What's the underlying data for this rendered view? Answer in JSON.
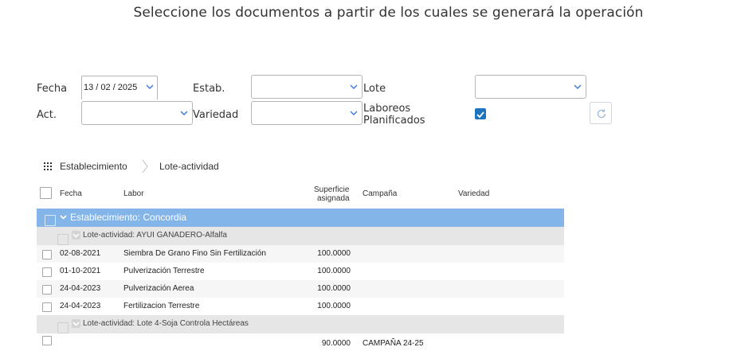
{
  "header": {
    "title": "Seleccione los documentos a partir de los cuales se generará la operación"
  },
  "filters": {
    "fecha_label": "Fecha",
    "fecha_value": "13 / 02 / 2025",
    "estab_label": "Estab.",
    "lote_label": "Lote",
    "act_label": "Act.",
    "variedad_label": "Variedad",
    "laboreos_label_1": "Laboreos",
    "laboreos_label_2": "Planificados",
    "laboreos_checked": true
  },
  "groupby": {
    "items": [
      "Establecimiento",
      "Lote-actividad"
    ]
  },
  "grid": {
    "columns": {
      "fecha": "Fecha",
      "labor": "Labor",
      "superficie_1": "Superficie",
      "superficie_2": "asignada",
      "campana": "Campaña",
      "variedad": "Variedad"
    },
    "group1": "Establecimiento: Concordia",
    "subgroups": [
      {
        "label": "Lote-actividad: AYUI GANADERO-Alfalfa",
        "rows": [
          {
            "fecha": "02-08-2021",
            "labor": "Siembra De Grano Fino Sin Fertilización",
            "superficie": "100.0000",
            "campana": "",
            "variedad": ""
          },
          {
            "fecha": "01-10-2021",
            "labor": "Pulverización Terrestre",
            "superficie": "100.0000",
            "campana": "",
            "variedad": ""
          },
          {
            "fecha": "24-04-2023",
            "labor": "Pulverización Aerea",
            "superficie": "100.0000",
            "campana": "",
            "variedad": ""
          },
          {
            "fecha": "24-04-2023",
            "labor": "Fertilizacion Terrestre",
            "superficie": "100.0000",
            "campana": "",
            "variedad": ""
          }
        ]
      },
      {
        "label": "Lote-actividad: Lote 4-Soja Controla Hectáreas",
        "rows": [
          {
            "fecha": "",
            "labor": "",
            "superficie": "90.0000",
            "campana": "CAMPAÑA 24-25",
            "variedad": ""
          }
        ]
      }
    ]
  },
  "colors": {
    "group_header": "#84b5e8",
    "subgroup_header": "#e6e6e6",
    "checkbox_accent": "#1e73be"
  }
}
